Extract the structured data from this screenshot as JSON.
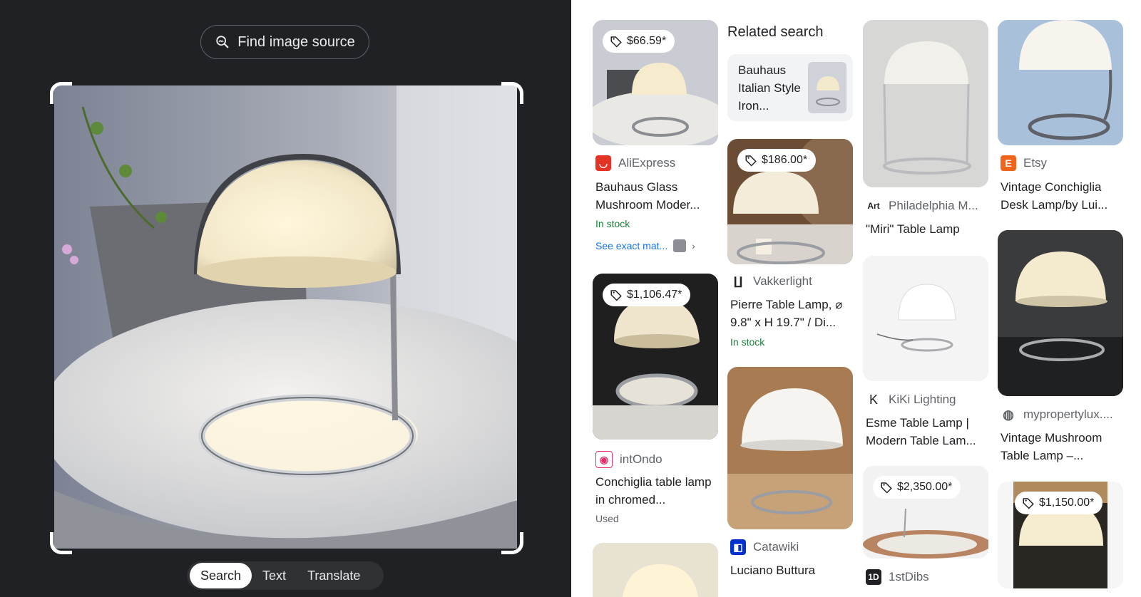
{
  "lens": {
    "find_source_label": "Find image source",
    "modes": [
      "Search",
      "Text",
      "Translate"
    ],
    "active_mode": "Search"
  },
  "related": {
    "heading": "Related search",
    "query": "Bauhaus Italian Style Iron..."
  },
  "results": {
    "aliexpress": {
      "price": "$66.59*",
      "source": "AliExpress",
      "title": "Bauhaus Glass Mushroom Moder...",
      "stock": "In stock",
      "exact": "See exact mat..."
    },
    "intondo": {
      "price": "$1,106.47*",
      "source": "intOndo",
      "title": "Conchiglia table lamp in chromed...",
      "condition": "Used"
    },
    "vakkerlight": {
      "price": "$186.00*",
      "source": "Vakkerlight",
      "title": "Pierre Table Lamp, ⌀ 9.8\" x H 19.7\" / Di...",
      "stock": "In stock"
    },
    "catawiki": {
      "source": "Catawiki",
      "title": "Luciano Buttura"
    },
    "philadelphia": {
      "source": "Philadelphia M...",
      "title": "\"Miri\" Table Lamp"
    },
    "kiki": {
      "source": "KiKi Lighting",
      "title": "Esme Table Lamp | Modern Table Lam..."
    },
    "firstdibs": {
      "price": "$2,350.00*",
      "source": "1stDibs"
    },
    "etsy": {
      "source": "Etsy",
      "title": "Vintage Conchiglia Desk Lamp/by Lui..."
    },
    "mypropertylux": {
      "source": "mypropertylux....",
      "title": "Vintage Mushroom Table Lamp –..."
    },
    "last": {
      "price": "$1,150.00*"
    }
  },
  "colors": {
    "stock_green": "#188038",
    "link_blue": "#1a73e8",
    "dark_bg": "#202124"
  }
}
